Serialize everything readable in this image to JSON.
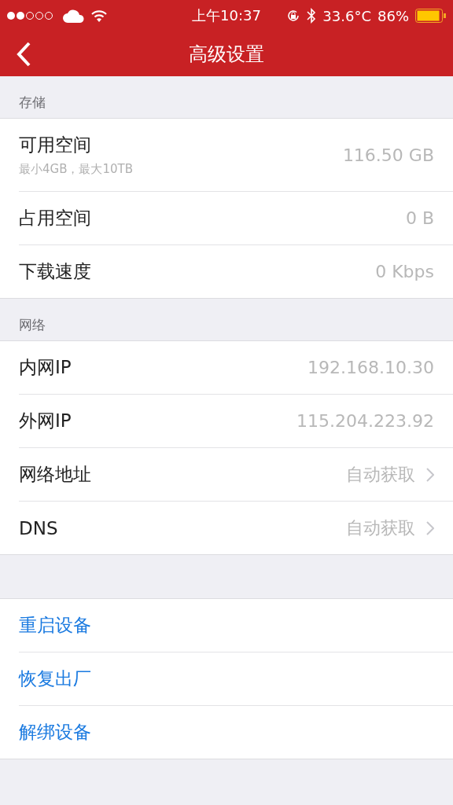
{
  "status_bar": {
    "time": "上午10:37",
    "temperature": "33.6°C",
    "battery": "86%"
  },
  "nav": {
    "title": "高级设置"
  },
  "sections": [
    {
      "header": "存储",
      "rows": [
        {
          "kind": "value",
          "label": "可用空间",
          "sublabel": "最小4GB，最大10TB",
          "value": "116.50 GB"
        },
        {
          "kind": "value",
          "label": "占用空间",
          "value": "0 B"
        },
        {
          "kind": "value",
          "label": "下载速度",
          "value": "0 Kbps"
        }
      ]
    },
    {
      "header": "网络",
      "rows": [
        {
          "kind": "value",
          "label": "内网IP",
          "value": "192.168.10.30"
        },
        {
          "kind": "value",
          "label": "外网IP",
          "value": "115.204.223.92"
        },
        {
          "kind": "link",
          "label": "网络地址",
          "value": "自动获取"
        },
        {
          "kind": "link",
          "label": "DNS",
          "value": "自动获取"
        }
      ]
    },
    {
      "rows": [
        {
          "kind": "action",
          "label": "重启设备"
        },
        {
          "kind": "action",
          "label": "恢复出厂"
        },
        {
          "kind": "action",
          "label": "解绑设备"
        }
      ]
    }
  ]
}
